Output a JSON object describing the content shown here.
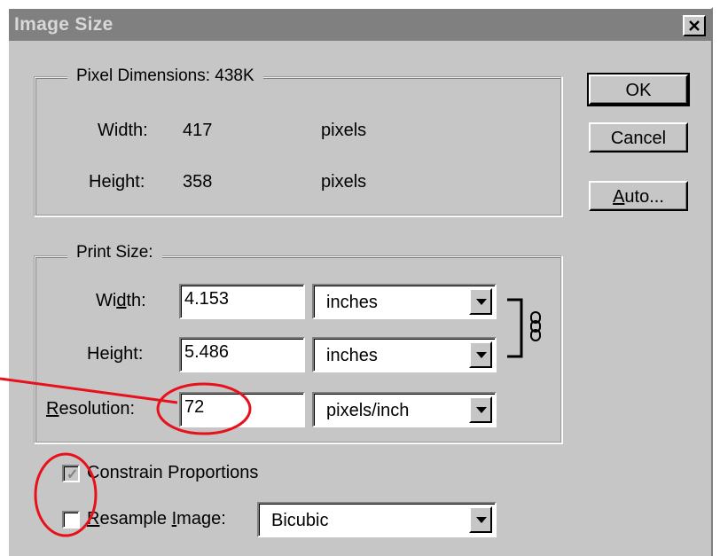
{
  "window": {
    "title": "Image Size",
    "close_glyph": "×"
  },
  "buttons": {
    "ok": "OK",
    "cancel": "Cancel",
    "auto_pre": "",
    "auto_key": "A",
    "auto_post": "uto..."
  },
  "pixel_dimensions": {
    "legend": "Pixel Dimensions:  438K",
    "width_label": "Width:",
    "width_value": "417",
    "width_unit": "pixels",
    "height_label": "Height:",
    "height_value": "358",
    "height_unit": "pixels"
  },
  "print_size": {
    "legend": "Print Size:",
    "width_label_pre": "Wi",
    "width_label_key": "d",
    "width_label_post": "th:",
    "width_value": "4.153",
    "width_unit": "inches",
    "height_label_pre": "Hei",
    "height_label_key": "g",
    "height_label_post": "ht:",
    "height_value": "5.486",
    "height_unit": "inches",
    "resolution_label_key": "R",
    "resolution_label_post": "esolution:",
    "resolution_value": "72",
    "resolution_unit": "pixels/inch",
    "link_icon": "chain-link-icon"
  },
  "options": {
    "constrain_label": "Constrain Proportions",
    "constrain_checked": true,
    "constrain_disabled": true,
    "resample_label_key": "R",
    "resample_label_mid": "esample ",
    "resample_label_key2": "I",
    "resample_label_post": "mage:",
    "resample_checked": false,
    "resample_method": "Bicubic"
  },
  "annotations": {
    "color": "#e8101a"
  }
}
